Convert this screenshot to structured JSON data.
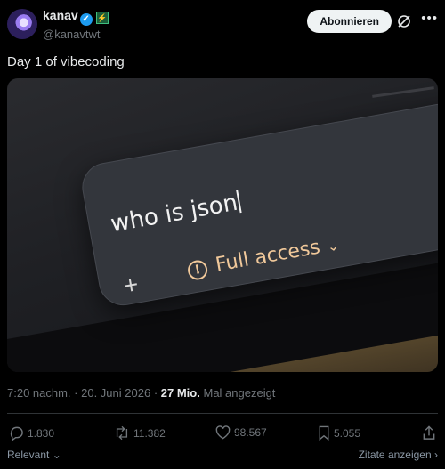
{
  "author": {
    "name": "kanav",
    "handle": "@kanavtwt"
  },
  "follow_label": "Abonnieren",
  "tweet": {
    "text": "Day 1 of vibecoding",
    "time": "7:20 nachm.",
    "date": "20. Juni 2026",
    "views": "27 Mio.",
    "views_suffix": "Mal angezeigt"
  },
  "media": {
    "prompt_text": "who is json",
    "access_label": "Full access",
    "plus_symbol": "+"
  },
  "stats": {
    "replies": "1.830",
    "reposts": "11.382",
    "likes": "98.567",
    "bookmarks": "5.055"
  },
  "footer": {
    "sort_label": "Relevant",
    "quotes_label": "Zitate anzeigen"
  },
  "icons": {
    "verified": "verified-check-icon",
    "grok": "grok-icon",
    "more": "more-icon"
  }
}
